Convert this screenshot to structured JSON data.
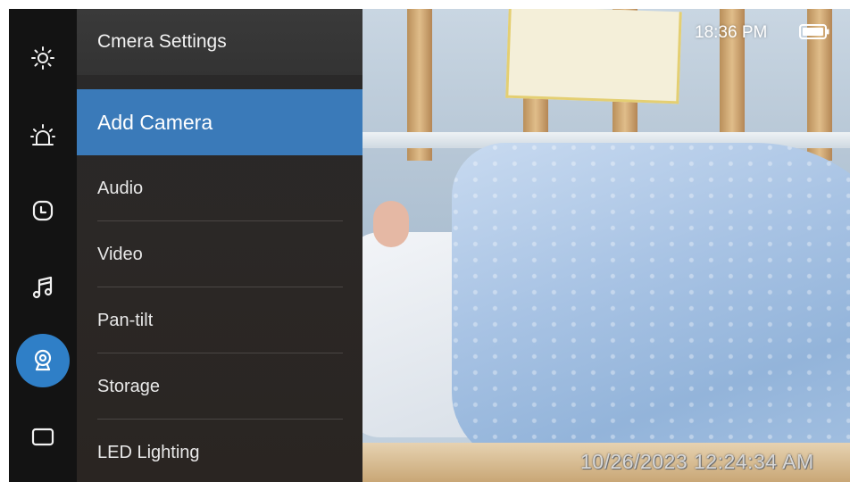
{
  "status": {
    "time": "18:36 PM",
    "timestamp": "10/26/2023 12:24:34 AM"
  },
  "nav": {
    "items": [
      {
        "icon": "brightness-icon"
      },
      {
        "icon": "alarm-icon"
      },
      {
        "icon": "clock-icon"
      },
      {
        "icon": "music-icon"
      },
      {
        "icon": "camera-icon",
        "active": true
      },
      {
        "icon": "screen-icon"
      }
    ]
  },
  "menu": {
    "title": "Cmera Settings",
    "items": [
      {
        "label": "Add Camera",
        "selected": true
      },
      {
        "label": "Audio"
      },
      {
        "label": "Video"
      },
      {
        "label": "Pan-tilt"
      },
      {
        "label": "Storage"
      },
      {
        "label": "LED Lighting"
      }
    ]
  },
  "colors": {
    "accent": "#2f7fc7",
    "selected_row": "#3a7ab9"
  }
}
